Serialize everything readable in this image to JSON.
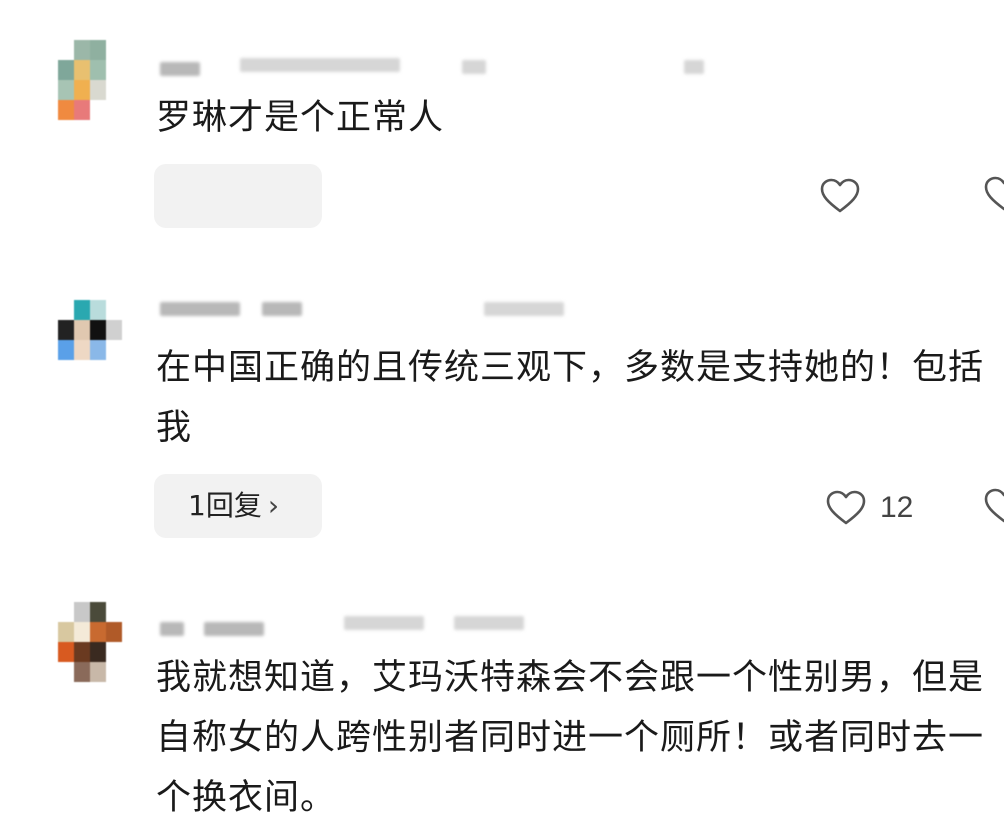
{
  "comments": [
    {
      "text": "罗琳才是个正常人",
      "reply_label": "",
      "like_count": ""
    },
    {
      "text": "在中国正确的且传统三观下，多数是支持她的！包括我",
      "reply_label": "1回复",
      "like_count": "12"
    },
    {
      "text": "我就想知道，艾玛沃特森会不会跟一个性别男，但是自称女的人跨性别者同时进一个厕所！或者同时去一个换衣间。",
      "reply_label": "",
      "like_count": ""
    }
  ],
  "icons": {
    "like": "heart-outline-icon",
    "reply_chevron": "chevron-right-icon"
  },
  "colors": {
    "reply_bg": "#f2f2f2",
    "icon_stroke": "#555555"
  }
}
